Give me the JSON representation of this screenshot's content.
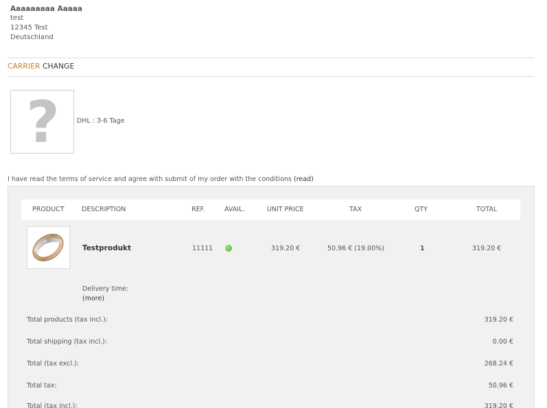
{
  "address": {
    "name": "Aaaaaaaaa Aaaaa",
    "line1": "test",
    "line2": "12345 Test",
    "line3": "Deutschland"
  },
  "carrier": {
    "heading_accent": "CARRIER",
    "heading_rest": "CHANGE",
    "image_icon": "question-mark-placeholder-icon",
    "name": "DHL : 3-6 Tage"
  },
  "terms": {
    "text": "I have read the terms of service and agree with submit of my order with the conditions",
    "link_label": "(read)"
  },
  "table": {
    "headers": {
      "product": "PRODUCT",
      "description": "DESCRIPTION",
      "ref": "REF.",
      "avail": "AVAIL.",
      "unit_price": "UNIT PRICE",
      "tax": "TAX",
      "qty": "QTY",
      "total": "TOTAL"
    },
    "rows": [
      {
        "image_icon": "ring-product-image",
        "description": "Testprodukt",
        "ref": "11111",
        "avail_status_color": "#4caf2a",
        "unit_price": "319.20 €",
        "tax": "50.96 € (19.00%)",
        "qty": "1",
        "total": "319.20 €",
        "delivery_label": "Delivery time:",
        "more_label": "(more)"
      }
    ]
  },
  "totals": [
    {
      "label": "Total products (tax incl.):",
      "value": "319.20 €"
    },
    {
      "label": "Total shipping (tax incl.):",
      "value": "0.00 €"
    },
    {
      "label": "Total (tax excl.):",
      "value": "268.24 €"
    },
    {
      "label": "Total tax:",
      "value": "50.96 €"
    },
    {
      "label": "Total (tax incl.):",
      "value": "319.20 €"
    }
  ],
  "colors": {
    "accent": "#b5862f",
    "panel_bg": "#f1f1f1",
    "header_bg": "#ffffff"
  }
}
